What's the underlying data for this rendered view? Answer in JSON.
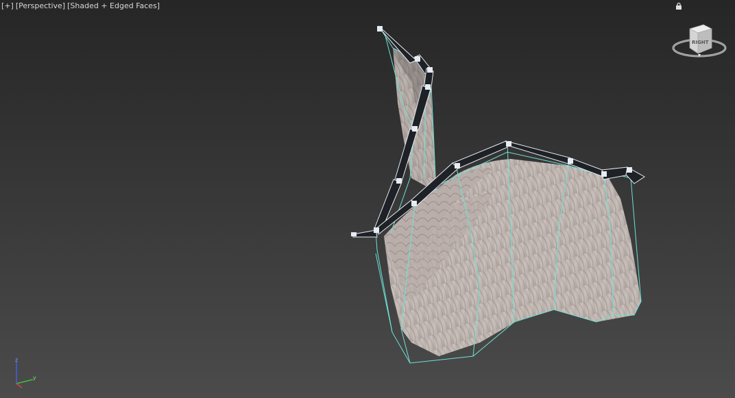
{
  "viewport": {
    "plus_label": "[+]",
    "view_label": "[Perspective]",
    "shading_label": "[Shaded + Edged Faces]"
  },
  "viewcube": {
    "face_label": "RIGHT",
    "icon": "viewcube-icon"
  },
  "axes": {
    "z_label": "z",
    "y_label": "y",
    "x_color": "#e04040",
    "y_color": "#40c040",
    "z_color": "#4060e0"
  },
  "colors": {
    "edge_color": "#6fe3d6",
    "bone_color": "#c8d2dc",
    "feather_color": "#c6bcb6"
  }
}
